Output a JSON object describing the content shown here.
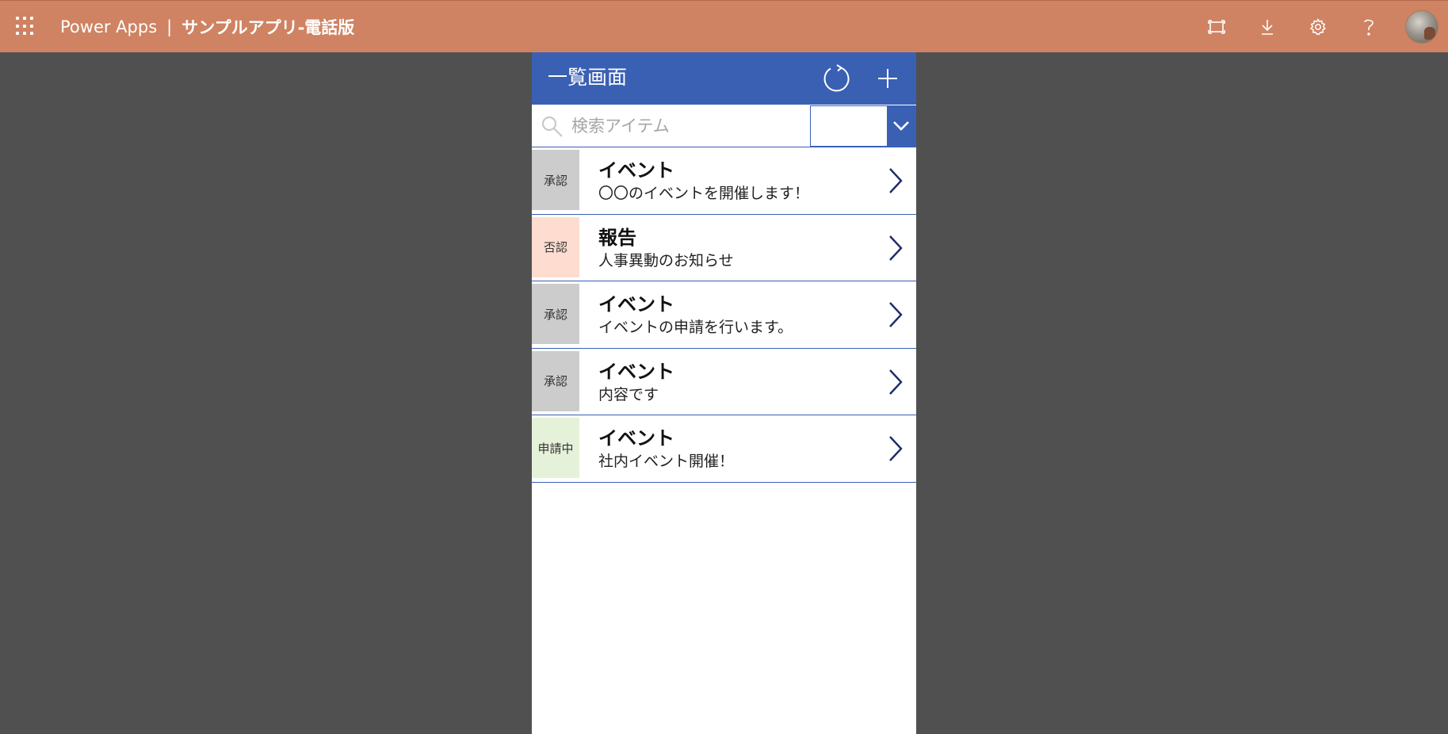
{
  "topbar": {
    "brand": "Power Apps",
    "separator": "|",
    "app_name": "サンプルアプリ-電話版",
    "colors": {
      "background": "#cf8362"
    },
    "icons": [
      "waffle-icon",
      "fit-screen-icon",
      "download-icon",
      "settings-icon",
      "help-icon",
      "avatar"
    ]
  },
  "app": {
    "title": "一覧画面",
    "colors": {
      "header": "#3a60b4",
      "accent": "#3a60b4",
      "canvas": "#505050"
    },
    "search": {
      "placeholder": "検索アイテム",
      "value": ""
    },
    "filter_dropdown": {
      "selected": ""
    },
    "items": [
      {
        "status": "承認",
        "status_color": "#cccccc",
        "title": "イベント",
        "subtitle": "〇〇のイベントを開催します！"
      },
      {
        "status": "否認",
        "status_color": "#ffdcd0",
        "title": "報告",
        "subtitle": "人事異動のお知らせ"
      },
      {
        "status": "承認",
        "status_color": "#cccccc",
        "title": "イベント",
        "subtitle": "イベントの申請を行います。"
      },
      {
        "status": "承認",
        "status_color": "#cccccc",
        "title": "イベント",
        "subtitle": "内容です"
      },
      {
        "status": "申請中",
        "status_color": "#e6f1da",
        "title": "イベント",
        "subtitle": "社内イベント開催！"
      }
    ]
  }
}
